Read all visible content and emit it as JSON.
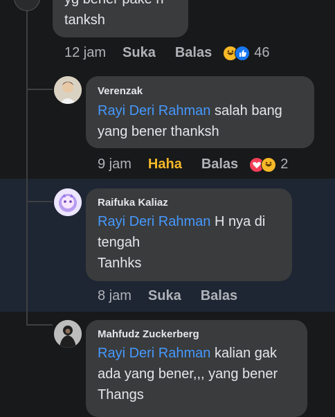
{
  "comments": [
    {
      "body_lines": [
        "yg bener pake h",
        "tanksh"
      ],
      "time": "12 jam",
      "actions": [
        "Suka",
        "Balas"
      ],
      "reaction_count": "46",
      "reaction_icons": [
        "haha-icon",
        "like-icon"
      ]
    },
    {
      "author": "Verenzak",
      "mention": "Rayi Deri Rahman",
      "body_rest": " salah bang",
      "body_line2": "yang bener thanksh",
      "time": "9 jam",
      "actions": [
        "Haha",
        "Balas"
      ],
      "reaction_count": "2",
      "reaction_icons": [
        "love-icon",
        "haha-icon"
      ]
    },
    {
      "author": "Raifuka Kaliaz",
      "mention": "Rayi Deri Rahman",
      "body_rest": " H nya di",
      "body_line2": "tengah",
      "body_line3": "Tanhks",
      "time": "8 jam",
      "actions": [
        "Suka",
        "Balas"
      ]
    },
    {
      "author": "Mahfudz Zuckerberg",
      "mention": "Rayi Deri Rahman",
      "body_rest": " kalian gak",
      "body_line2": "ada yang bener,,, yang bener",
      "body_line3": "Thangs"
    }
  ],
  "colors": {
    "background": "#18191a",
    "bubble": "#3a3b3c",
    "mention": "#4599ff",
    "haha_active": "#f7b928",
    "highlight_band": "#1e2533"
  }
}
